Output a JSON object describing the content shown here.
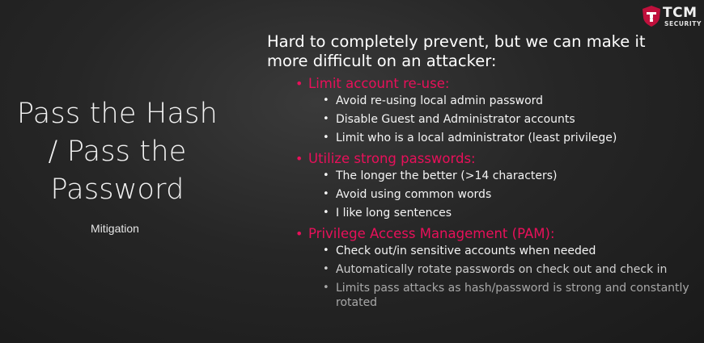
{
  "slide": {
    "title_lines": [
      "Pass the Hash",
      "/ Pass the",
      "Password"
    ],
    "subtitle": "Mitigation"
  },
  "logo": {
    "brand": "TCM",
    "brand_sub": "SECURITY",
    "icon": "tcm-shield-icon",
    "accent_color": "#c0103c"
  },
  "content": {
    "intro": [
      "Hard to completely prevent, but we can make it",
      "more difficult on an attacker:"
    ],
    "accent_color": "#e8105a",
    "sections": [
      {
        "heading": "Limit account re-use:",
        "items": [
          "Avoid re-using local admin password",
          "Disable Guest and Administrator accounts",
          "Limit who is a local administrator (least privilege)"
        ]
      },
      {
        "heading": "Utilize strong passwords:",
        "items": [
          "The longer the better (>14 characters)",
          "Avoid using common words",
          "I like long sentences"
        ]
      },
      {
        "heading": "Privilege Access Management (PAM):",
        "items": [
          "Check out/in sensitive accounts when needed",
          "Automatically rotate passwords on check out and check in",
          "Limits pass attacks as hash/password is strong and constantly rotated"
        ]
      }
    ]
  }
}
